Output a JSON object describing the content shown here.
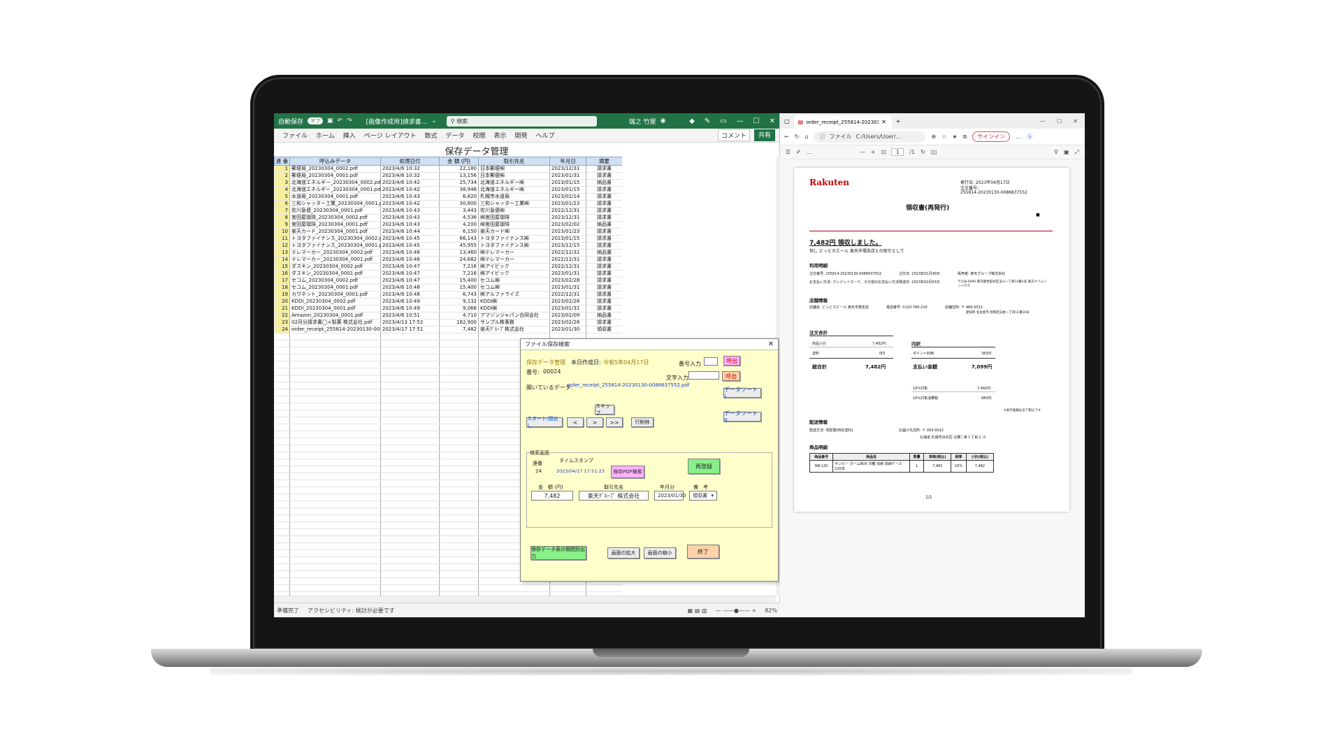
{
  "excel": {
    "autosave": "自動保存",
    "autosave_state": "オフ",
    "filename": "[画像作成用]請求書...",
    "search_placeholder": "検索",
    "user": "瑞之 竹屋",
    "menu": [
      "ファイル",
      "ホーム",
      "挿入",
      "ページ レイアウト",
      "数式",
      "データ",
      "校閲",
      "表示",
      "開発",
      "ヘルプ"
    ],
    "comment_btn": "コメント",
    "share_btn": "共有",
    "sheet_title": "保存データ管理",
    "columns": [
      "連 番",
      "呼込みデータ",
      "処理日付",
      "金 額 (円)",
      "取引先名",
      "年月日",
      "摘要"
    ],
    "rows": [
      [
        "1",
        "郵便局_20230304_0002.pdf",
        "2023/4/6 10:32",
        "22,180",
        "日本郵便㈱",
        "2023/12/31",
        "請求書"
      ],
      [
        "2",
        "郵便局_20230304_0001.pdf",
        "2023/4/6 10:32",
        "13,156",
        "日本郵便㈱",
        "2023/01/31",
        "請求書"
      ],
      [
        "3",
        "北海道エネルギー_20230304_0002.pdf",
        "2023/4/6 10:42",
        "25,734",
        "北海道エネルギー㈱",
        "2023/01/15",
        "納品書"
      ],
      [
        "4",
        "北海道エネルギー_20230304_0001.pdf",
        "2023/4/6 10:42",
        "38,946",
        "北海道エネルギー㈱",
        "2023/01/15",
        "請求書"
      ],
      [
        "5",
        "水道局_20230304_0001.pdf",
        "2023/4/6 10:43",
        "6,820",
        "札幌市水道局",
        "2023/02/14",
        "請求書"
      ],
      [
        "6",
        "三和シャッター工業_20230304_0001.pdf",
        "2023/4/6 10:42",
        "30,800",
        "三和シャッター工業㈱",
        "2023/01/23",
        "請求書"
      ],
      [
        "7",
        "佐川急便_20230304_0001.pdf",
        "2023/4/6 10:43",
        "3,443",
        "佐川急便㈱",
        "2022/12/31",
        "請求書"
      ],
      [
        "8",
        "宮田屋珈琲_20230304_0002.pdf",
        "2023/4/6 10:43",
        "4,536",
        "㈱宮田屋珈琲",
        "2023/12/31",
        "請求書"
      ],
      [
        "9",
        "宮田屋珈琲_20230304_0001.pdf",
        "2023/4/6 10:43",
        "4,200",
        "㈱宮田屋珈琲",
        "2023/02/02",
        "納品書"
      ],
      [
        "10",
        "楽天カード_20230304_0001.pdf",
        "2023/4/6 10:44",
        "6,150",
        "楽天カード㈱",
        "2023/01/23",
        "請求書"
      ],
      [
        "11",
        "トヨタファイナンス_20230304_0002.pdf",
        "2023/4/6 10:45",
        "66,143",
        "トヨタファイナンス㈱",
        "2023/01/15",
        "請求書"
      ],
      [
        "12",
        "トヨタファイナンス_20230304_0001.pdf",
        "2023/4/6 10:45",
        "45,955",
        "トヨタファイナンス㈱",
        "2023/12/15",
        "請求書"
      ],
      [
        "13",
        "テレマーカー_20230304_0002.pdf",
        "2023/4/6 10:46",
        "13,460",
        "㈱テレマーカー",
        "2022/12/31",
        "納品書"
      ],
      [
        "14",
        "テレマーカー_20230304_0001.pdf",
        "2023/4/6 10:46",
        "24,682",
        "㈱テレマーカー",
        "2022/12/31",
        "請求書"
      ],
      [
        "15",
        "ダスキン_20230304_0002.pdf",
        "2023/4/6 10:47",
        "7,216",
        "㈱アイビック",
        "2022/12/31",
        "請求書"
      ],
      [
        "16",
        "ダスキン_20230304_0001.pdf",
        "2023/4/6 10:47",
        "7,216",
        "㈱アイビック",
        "2023/01/31",
        "請求書"
      ],
      [
        "17",
        "セコム_20230304_0002.pdf",
        "2023/4/6 10:47",
        "15,400",
        "セコム㈱",
        "2023/02/28",
        "請求書"
      ],
      [
        "18",
        "セコム_20230304_0001.pdf",
        "2023/4/6 10:48",
        "15,400",
        "セコム㈱",
        "2023/01/31",
        "請求書"
      ],
      [
        "19",
        "カワネット_20230304_0001.pdf",
        "2023/4/6 10:48",
        "6,743",
        "㈱アルファライズ",
        "2022/12/31",
        "請求書"
      ],
      [
        "20",
        "KDDI_20230304_0002.pdf",
        "2023/4/6 10:49",
        "9,132",
        "KDDI㈱",
        "2023/02/28",
        "請求書"
      ],
      [
        "21",
        "KDDI_20230304_0001.pdf",
        "2023/4/6 10:49",
        "9,066",
        "KDDI㈱",
        "2023/01/31",
        "請求書"
      ],
      [
        "22",
        "Amazon_20230304_0001.pdf",
        "2023/4/6 10:51",
        "4,710",
        "アマゾンジャパン合同会社",
        "2023/02/09",
        "納品書"
      ],
      [
        "23",
        "02月分請求書◯×製菓 株式会社.pdf",
        "2023/4/13 17:52",
        "162,900",
        "サンプル株事務",
        "2023/02/28",
        "請求書"
      ],
      [
        "24",
        "order_receipt_255814-20230130-00866375",
        "2023/4/17 17:51",
        "7,482",
        "楽天ｸﾞﾙｰﾌﾟ株式会社",
        "2023/01/30",
        "領収書"
      ]
    ],
    "status_ready": "準備完了",
    "status_accessibility": "アクセシビリティ: 検討が必要です",
    "zoom": "82%"
  },
  "dialog": {
    "title": "ファイル保存検索",
    "section": "保存データ管理",
    "created_label": "本日作成日:",
    "created_value": "令和5年04月17日",
    "num_input_label": "番号入力",
    "call_btn": "呼出",
    "number_label": "番号:",
    "number_value": "00024",
    "text_input_label": "文字入力",
    "call_btn2": "呼出",
    "open_data_label": "開いているデータ:",
    "open_data_value": "order_receipt_255814-20230130-0086637552.pdf",
    "sort1": "データソート I",
    "sort2": "データソート II",
    "skip": "スキップ",
    "start_head": "スタート/頭出し",
    "prev": "<",
    "next": ">",
    "last": ">>",
    "delete_row": "行削除",
    "search_screen": "検索画面",
    "seq_label": "連番",
    "seq_value": "24",
    "timestamp_label": "タイムスタンプ",
    "timestamp_value": "2023/04/17 17:51:23",
    "pdf_search": "保存PDF検索",
    "reregister": "再登録",
    "amount_label": "金　額 (円)",
    "partner_label": "取引先名",
    "ym_label": "年月分",
    "note_label": "備　考",
    "amount_value": "7,482",
    "partner_value": "楽天ｸﾞﾙｰﾌﾟ 株式会社",
    "ym_value": "2023/01/30",
    "note_value": "領収書",
    "period_output": "保存データ表の期間別出力",
    "enlarge": "画面の拡大",
    "shrink": "画面の縮小",
    "finish": "終了"
  },
  "browser": {
    "tab_title": "order_receipt_255814-20230130...",
    "file_label": "ファイル",
    "url": "C:/Users/User/...",
    "signin": "サインイン",
    "page_current": "1",
    "page_total": "/1"
  },
  "pdf": {
    "logo": "Rakuten",
    "issue_date": "発行日: 2023年04月17日",
    "order_no_label": "注文番号:",
    "order_no": "255814-20230130-0086637552",
    "title": "領収書(再発行)",
    "received": "7,482円 領収しました。",
    "received_sub": "但し どっとカエール 楽天市場支店との取引として",
    "usage_section": "利用明細",
    "usage_line1_a": "注文番号: 255814-20230130-0086637552",
    "usage_line1_b": "注文日: 2023年01月30日",
    "usage_line1_c": "販売者: 楽天グループ株式会社",
    "usage_line2_a": "お支払い方法: クレジットカード、その他のお支払い方法",
    "usage_line2_b": "発送日: 2023年02月03日",
    "usage_line2_c": "〒158-0094 東京都世田谷区玉川一丁目14番1号 楽天クリムゾンハウス",
    "shop_section": "店舗情報",
    "shop_name": "店舗名: どっとカエール 楽天市場支店",
    "shop_tel": "電話番号: 0120-780-210",
    "shop_addr": "店舗住所: 〒 466-0012",
    "shop_addr2": "愛知県 名古屋市 昭和区白金一丁目11番10号",
    "total_section": "注文合計",
    "subtotal_label": "商品小計",
    "subtotal_value": "7,482円",
    "shipping_label": "送料",
    "shipping_value": "0円",
    "grand_label": "総合計",
    "grand_value": "7,482円",
    "breakdown_section": "内訳",
    "points_label": "ポイント利用",
    "points_value": "383円",
    "paid_label": "支払い金額",
    "paid_value": "7,099円",
    "tax_target_label": "10%対象",
    "tax_target_value": "7,482円",
    "tax_label": "10%対象消費税",
    "tax_value": "680円",
    "tax_note": "※表示金額は全て税込です",
    "delivery_section": "配送情報",
    "delivery_method": "配送方法: 宅配便[特定送料]",
    "delivery_to": "お届け先住所: 〒 003-0022",
    "delivery_addr": "北海道 札幌市白石区 北郷二条１丁目２-６",
    "items_section": "商品明細",
    "item_headers": [
      "商品番号",
      "商品名",
      "数量",
      "単価(税込)",
      "税率",
      "小計(税込)"
    ],
    "item_row": [
      "NB-120",
      "サンビー ホームBOX 印鑑 収納 収納ケース 120本",
      "1",
      "7,482",
      "10%",
      "7,482"
    ],
    "page_footer": "1/1"
  }
}
